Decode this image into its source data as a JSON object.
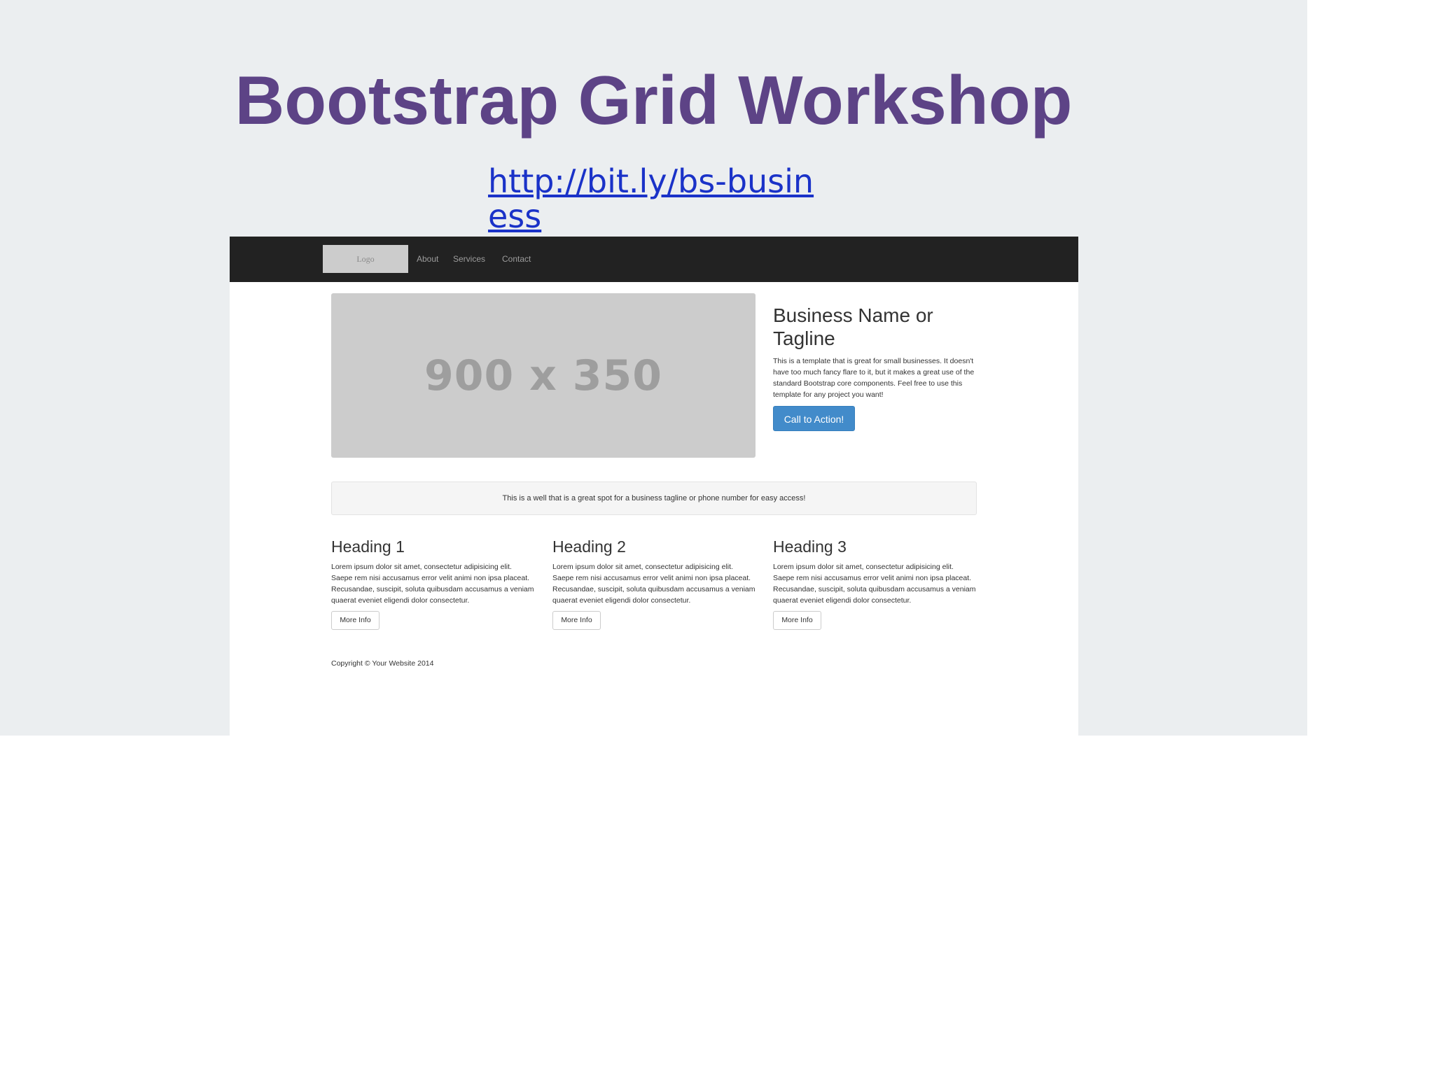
{
  "slide": {
    "title": "Bootstrap Grid Workshop",
    "link": "http://bit.ly/bs-business",
    "background": "#ebeef0",
    "title_color": "#5d4386",
    "link_color": "#1a32c8"
  },
  "screenshot": {
    "navbar": {
      "logo": "Logo",
      "links": [
        "About",
        "Services",
        "Contact"
      ],
      "background": "#222222"
    },
    "hero": {
      "image_label": "900 x 350",
      "title": "Business Name or Tagline",
      "text": "This is a template that is great for small businesses. It doesn't have too much fancy flare to it, but it makes a great use of the standard Bootstrap core components. Feel free to use this template for any project you want!",
      "cta_label": "Call to Action!",
      "cta_color": "#428bca"
    },
    "well_text": "This is a well that is a great spot for a business tagline or phone number for easy access!",
    "columns": [
      {
        "heading": "Heading 1",
        "text": "Lorem ipsum dolor sit amet, consectetur adipisicing elit. Saepe rem nisi accusamus error velit animi non ipsa placeat. Recusandae, suscipit, soluta quibusdam accusamus a veniam quaerat eveniet eligendi dolor consectetur.",
        "button": "More Info"
      },
      {
        "heading": "Heading 2",
        "text": "Lorem ipsum dolor sit amet, consectetur adipisicing elit. Saepe rem nisi accusamus error velit animi non ipsa placeat. Recusandae, suscipit, soluta quibusdam accusamus a veniam quaerat eveniet eligendi dolor consectetur.",
        "button": "More Info"
      },
      {
        "heading": "Heading 3",
        "text": "Lorem ipsum dolor sit amet, consectetur adipisicing elit. Saepe rem nisi accusamus error velit animi non ipsa placeat. Recusandae, suscipit, soluta quibusdam accusamus a veniam quaerat eveniet eligendi dolor consectetur.",
        "button": "More Info"
      }
    ],
    "footer": "Copyright © Your Website 2014"
  }
}
